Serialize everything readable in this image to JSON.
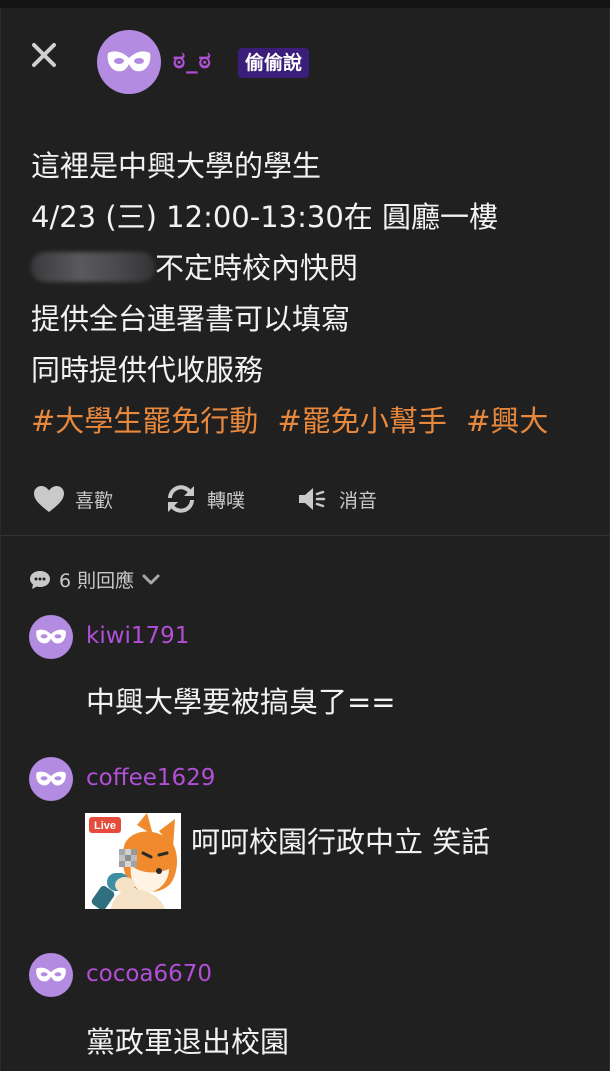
{
  "header": {
    "close_icon": "close-icon",
    "avatar_icon": "mask-icon",
    "author_name": "ಠ_ಠ",
    "author_badge": "偷偷說"
  },
  "post": {
    "lines": [
      "這裡是中興大學的學生",
      "4/23 (三) 12:00-13:30在 圓廳一樓",
      "不定時校內快閃",
      "提供全台連署書可以填寫",
      "同時提供代收服務"
    ],
    "hashtags": [
      "#大學生罷免行動",
      "#罷免小幫手",
      "#興大"
    ]
  },
  "actions": {
    "like_label": "喜歡",
    "repost_label": "轉噗",
    "mute_label": "消音"
  },
  "replies": {
    "count_label": "6 則回應",
    "items": [
      {
        "user": "kiwi1791",
        "text": "中興大學要被搞臭了=="
      },
      {
        "user": "coffee1629",
        "text": "呵呵校園行政中立 笑話",
        "sticker_label": "Live"
      },
      {
        "user": "cocoa6670",
        "text": "黨政軍退出校園"
      }
    ]
  },
  "colors": {
    "background": "#202021",
    "username": "#b14fd6",
    "badge_bg": "#3a1e7a",
    "hashtag": "#e8883c",
    "avatar": "#b38be0"
  }
}
